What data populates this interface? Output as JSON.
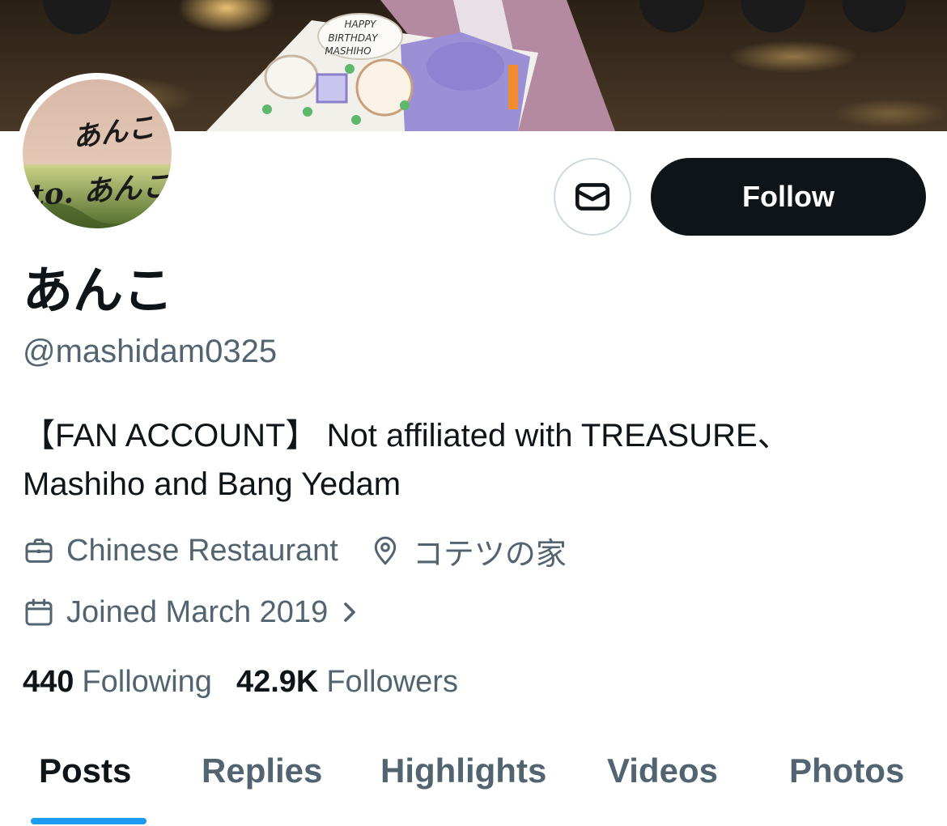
{
  "banner": {
    "cake_text": [
      "HAPPY",
      "BIRTHDAY",
      "MASHIHO"
    ]
  },
  "avatar": {
    "handwriting": [
      "あんこ",
      "to. あんこ"
    ]
  },
  "actions": {
    "message_icon": "envelope-icon",
    "follow_label": "Follow"
  },
  "profile": {
    "display_name": "あんこ",
    "handle": "@mashidam0325",
    "bio_line1": "【FAN ACCOUNT】 Not affiliated with TREASURE、",
    "bio_line2": "Mashiho and Bang Yedam",
    "profession": "Chinese Restaurant",
    "location": "コテツの家",
    "joined": "Joined March 2019"
  },
  "stats": {
    "following_count": "440",
    "following_label": "Following",
    "followers_count": "42.9K",
    "followers_label": "Followers"
  },
  "tabs": {
    "items": [
      {
        "label": "Posts"
      },
      {
        "label": "Replies"
      },
      {
        "label": "Highlights"
      },
      {
        "label": "Videos"
      },
      {
        "label": "Photos"
      }
    ],
    "active": "Posts"
  },
  "colors": {
    "primary_text": "#0f1419",
    "secondary_text": "#536471",
    "accent": "#1d9bf0",
    "border": "#cfd9de"
  }
}
